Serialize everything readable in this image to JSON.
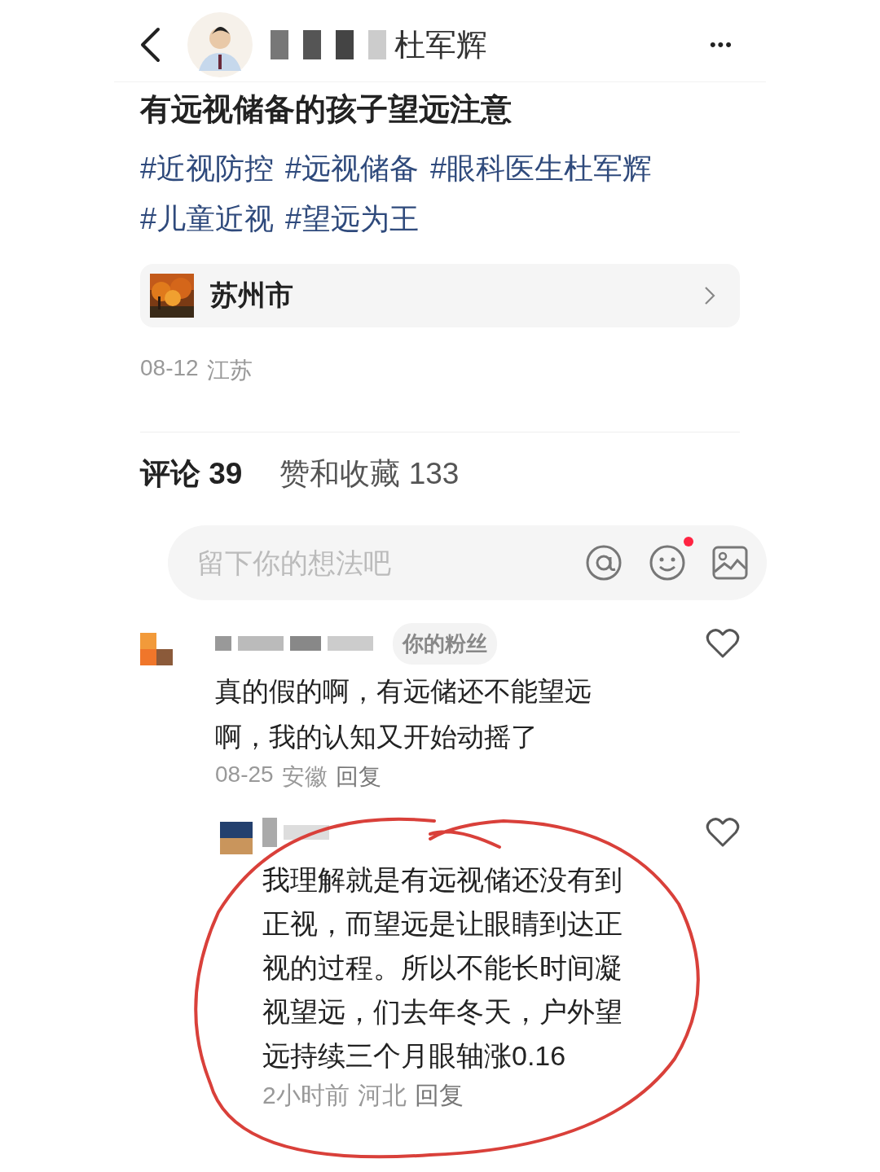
{
  "header": {
    "author": "杜军辉",
    "more": "•••"
  },
  "post": {
    "title": "有远视储备的孩子望远注意",
    "tag_lines": [
      [
        "#近视防控",
        "#远视储备",
        "#眼科医生杜军辉"
      ],
      [
        "#儿童近视",
        "#望远为王"
      ]
    ],
    "location": "苏州市",
    "date": "08-12",
    "region": "江苏"
  },
  "tabs": [
    {
      "label": "评论 39",
      "selected": true
    },
    {
      "label": "赞和收藏 133",
      "selected": false
    }
  ],
  "comment_input": {
    "placeholder": "留下你的想法吧",
    "emoji_dot": true
  },
  "comments": [
    {
      "badge": "你的粉丝",
      "text": "真的假的啊，有远储还不能望远啊，我的认知又开始动摇了",
      "time": "08-25",
      "region": "安徽",
      "reply": "回复",
      "children": [
        {
          "text": "我理解就是有远视储还没有到正视，而望远是让眼睛到达正视的过程。所以不能长时间凝视望远，们去年冬天，户外望远持续三个月眼轴涨0.16",
          "time": "2小时前",
          "region": "河北",
          "reply": "回复"
        }
      ]
    }
  ]
}
